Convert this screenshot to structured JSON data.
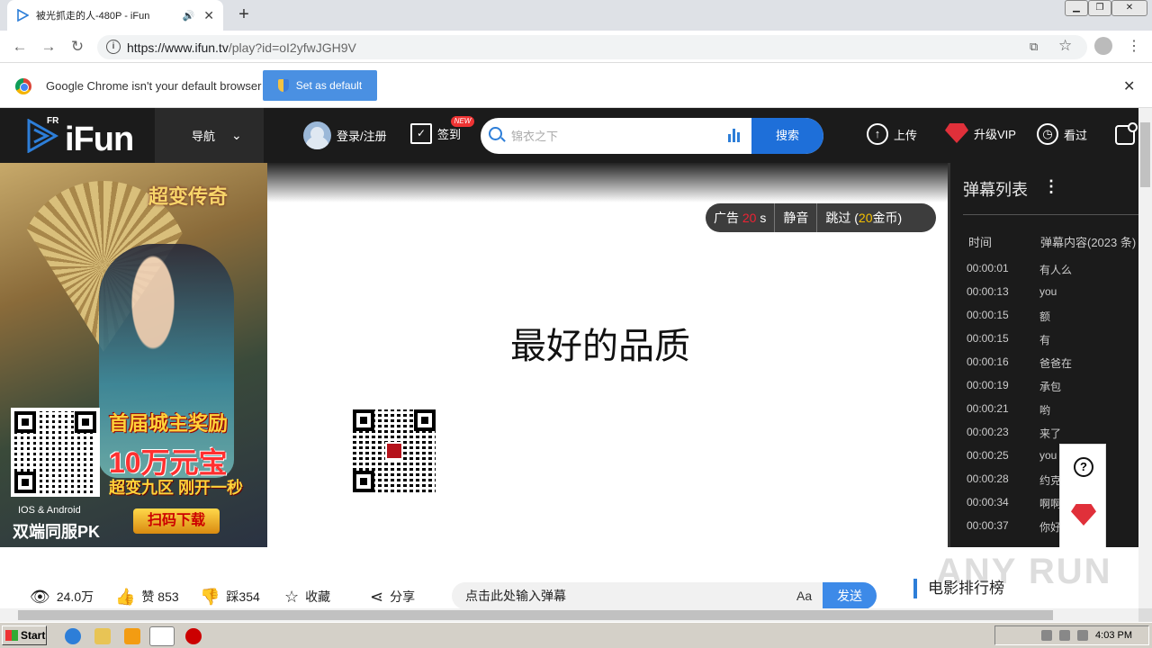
{
  "browser": {
    "tab_title": "被光抓走的人-480P - iFun",
    "url_host": "https://www.ifun.tv",
    "url_path": "/play?id=oI2yfwJGH9V"
  },
  "infobar": {
    "message": "Google Chrome isn't your default browser",
    "button": "Set as default"
  },
  "site": {
    "logo_fr": "FR",
    "logo_name": "iFun",
    "nav_label": "导航",
    "login_label": "登录/注册",
    "signin_label": "签到",
    "new_badge": "NEW",
    "search_placeholder": "锦衣之下",
    "search_button": "搜索",
    "upload_label": "上传",
    "vip_label": "升级VIP",
    "history_label": "看过"
  },
  "left_ad": {
    "game_title": "超变传奇",
    "promo_line1": "首届城主奖励",
    "promo_line2": "10万元宝",
    "promo_line3": "超变九区 刚开一秒",
    "platforms": "IOS & Android",
    "pk": "双端同服PK",
    "scan_button": "扫码下载"
  },
  "player": {
    "ad_label": "广告",
    "ad_seconds": "20",
    "ad_unit": "s",
    "mute_label": "静音",
    "skip_prefix": "跳过 (",
    "skip_coins": "20",
    "skip_suffix": "金币)",
    "quality_text": "最好的品质"
  },
  "danmaku": {
    "title": "弹幕列表",
    "col_time": "时间",
    "col_content": "弹幕内容(2023 条)",
    "rows": [
      {
        "time": "00:00:01",
        "text": "有人么"
      },
      {
        "time": "00:00:13",
        "text": "you"
      },
      {
        "time": "00:00:15",
        "text": "额"
      },
      {
        "time": "00:00:15",
        "text": "有"
      },
      {
        "time": "00:00:16",
        "text": "爸爸在"
      },
      {
        "time": "00:00:19",
        "text": "承包"
      },
      {
        "time": "00:00:21",
        "text": "哟"
      },
      {
        "time": "00:00:23",
        "text": "来了"
      },
      {
        "time": "00:00:25",
        "text": "you"
      },
      {
        "time": "00:00:28",
        "text": "约克"
      },
      {
        "time": "00:00:34",
        "text": "啊啊"
      },
      {
        "time": "00:00:37",
        "text": "你好"
      }
    ]
  },
  "bottom": {
    "views": "24.0万",
    "likes": "赞 853",
    "dislikes": "踩354",
    "favorite": "收藏",
    "share": "分享",
    "danmaku_placeholder": "点击此处输入弹幕",
    "font_toggle": "Aa",
    "send": "发送",
    "movie_rank": "电影排行榜"
  },
  "watermark": "ANY RUN",
  "taskbar": {
    "start": "Start",
    "clock": "4:03 PM"
  }
}
